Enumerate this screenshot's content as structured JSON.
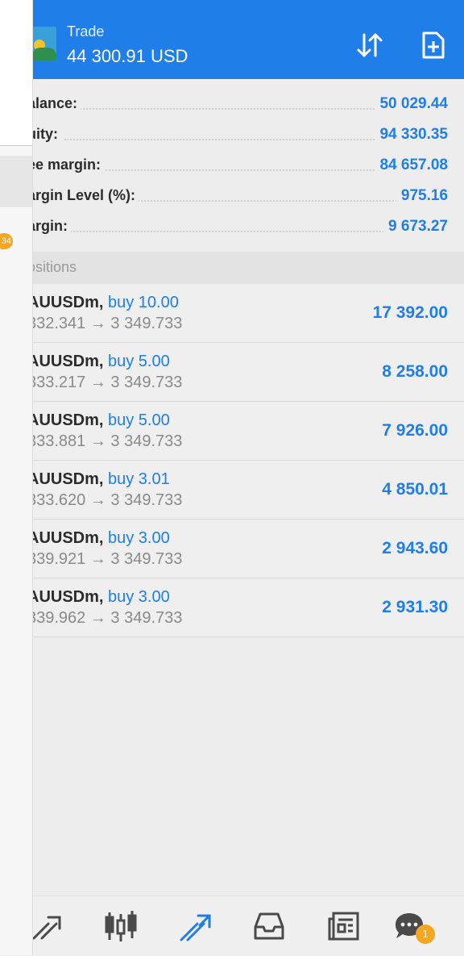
{
  "header": {
    "title": "Trade",
    "balance_line": "44 300.91 USD",
    "color": "#1f7ee8",
    "icons": [
      "sort-icon",
      "new-order-icon"
    ]
  },
  "summary": [
    {
      "label": "alance:",
      "value": "50 029.44"
    },
    {
      "label": "uity:",
      "value": "94 330.35"
    },
    {
      "label": "ee margin:",
      "value": "84 657.08"
    },
    {
      "label": "argin Level (%):",
      "value": "975.16"
    },
    {
      "label": "argin:",
      "value": "9 673.27"
    }
  ],
  "positions_header": "ositions",
  "positions": [
    {
      "symbol": "AUUSDm,",
      "side": "buy 10.00",
      "prices": "332.341 → 3 349.733",
      "profit": "17 392.00"
    },
    {
      "symbol": "AUUSDm,",
      "side": "buy 5.00",
      "prices": "333.217 → 3 349.733",
      "profit": "8 258.00"
    },
    {
      "symbol": "AUUSDm,",
      "side": "buy 5.00",
      "prices": "333.881 → 3 349.733",
      "profit": "7 926.00"
    },
    {
      "symbol": "AUUSDm,",
      "side": "buy 3.01",
      "prices": "333.620 → 3 349.733",
      "profit": "4 850.01"
    },
    {
      "symbol": "AUUSDm,",
      "side": "buy 3.00",
      "prices": "339.921 → 3 349.733",
      "profit": "2 943.60"
    },
    {
      "symbol": "AUUSDm,",
      "side": "buy 3.00",
      "prices": "339.962 → 3 349.733",
      "profit": "2 931.30"
    }
  ],
  "drawer": {
    "badge": "34"
  },
  "bottom_nav": {
    "items": [
      "quotes-icon",
      "chart-icon",
      "trade-icon",
      "history-icon",
      "news-icon",
      "chat-icon"
    ],
    "active": "trade-icon",
    "chat_badge": "1"
  }
}
